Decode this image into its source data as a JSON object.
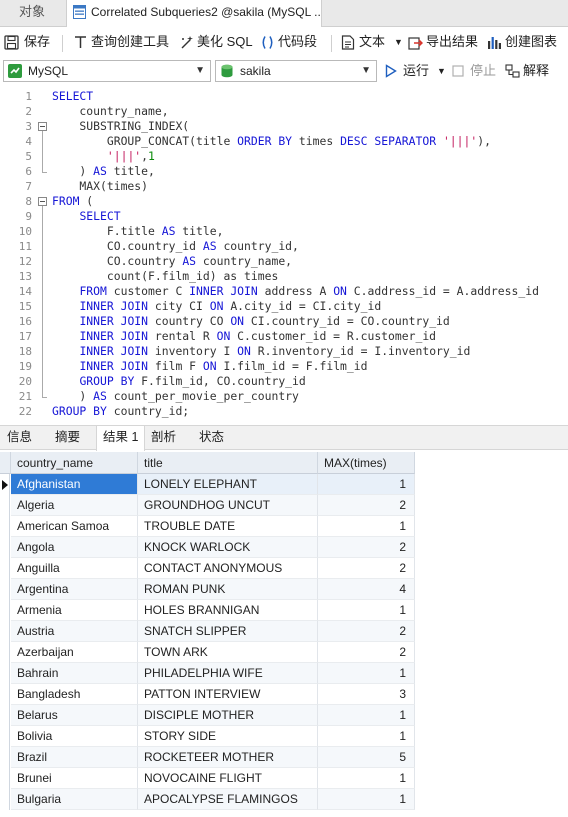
{
  "tabs": {
    "objects": "对象",
    "query": "Correlated Subqueries2 @sakila (MySQL ..."
  },
  "toolbar": {
    "save": "保存",
    "query_builder": "查询创建工具",
    "beautify": "美化 SQL",
    "snippet": "代码段",
    "text": "文本",
    "export": "导出结果",
    "create_chart": "创建图表"
  },
  "connection": {
    "server": "MySQL",
    "database": "sakila",
    "run": "运行",
    "stop": "停止",
    "explain": "解释"
  },
  "editor": {
    "lines": [
      {
        "n": "1",
        "html": "<span class='kw'>SELECT</span>"
      },
      {
        "n": "2",
        "html": "    country_name,"
      },
      {
        "n": "3",
        "html": "    SUBSTRING_INDEX("
      },
      {
        "n": "4",
        "html": "        GROUP_CONCAT(title <span class='kw'>ORDER BY</span> times <span class='kw'>DESC SEPARATOR</span> <span class='str'>'|||'</span>),"
      },
      {
        "n": "5",
        "html": "        <span class='str'>'|||'</span>,<span class='num'>1</span>"
      },
      {
        "n": "6",
        "html": "    ) <span class='kw'>AS</span> title,"
      },
      {
        "n": "7",
        "html": "    MAX(times)"
      },
      {
        "n": "8",
        "html": "<span class='kw'>FROM</span> ("
      },
      {
        "n": "9",
        "html": "    <span class='kw'>SELECT</span>"
      },
      {
        "n": "10",
        "html": "        F.title <span class='kw'>AS</span> title,"
      },
      {
        "n": "11",
        "html": "        CO.country_id <span class='kw'>AS</span> country_id,"
      },
      {
        "n": "12",
        "html": "        CO.country <span class='kw'>AS</span> country_name,"
      },
      {
        "n": "13",
        "html": "        count(F.film_id) as times"
      },
      {
        "n": "14",
        "html": "    <span class='kw'>FROM</span> customer C <span class='kw'>INNER JOIN</span> address A <span class='kw'>ON</span> C.address_id = A.address_id"
      },
      {
        "n": "15",
        "html": "    <span class='kw'>INNER JOIN</span> city CI <span class='kw'>ON</span> A.city_id = CI.city_id"
      },
      {
        "n": "16",
        "html": "    <span class='kw'>INNER JOIN</span> country CO <span class='kw'>ON</span> CI.country_id = CO.country_id"
      },
      {
        "n": "17",
        "html": "    <span class='kw'>INNER JOIN</span> rental R <span class='kw'>ON</span> C.customer_id = R.customer_id"
      },
      {
        "n": "18",
        "html": "    <span class='kw'>INNER JOIN</span> inventory I <span class='kw'>ON</span> R.inventory_id = I.inventory_id"
      },
      {
        "n": "19",
        "html": "    <span class='kw'>INNER JOIN</span> film F <span class='kw'>ON</span> I.film_id = F.film_id"
      },
      {
        "n": "20",
        "html": "    <span class='kw'>GROUP BY</span> F.film_id, CO.country_id"
      },
      {
        "n": "21",
        "html": "    ) <span class='kw'>AS</span> count_per_movie_per_country"
      },
      {
        "n": "22",
        "html": "<span class='kw'>GROUP BY</span> country_id;"
      }
    ]
  },
  "result_tabs": [
    "信息",
    "摘要",
    "结果 1",
    "剖析",
    "状态"
  ],
  "grid": {
    "columns": [
      "country_name",
      "title",
      "MAX(times)"
    ],
    "rows": [
      [
        "Afghanistan",
        "LONELY ELEPHANT",
        "1"
      ],
      [
        "Algeria",
        "GROUNDHOG UNCUT",
        "2"
      ],
      [
        "American Samoa",
        "TROUBLE DATE",
        "1"
      ],
      [
        "Angola",
        "KNOCK WARLOCK",
        "2"
      ],
      [
        "Anguilla",
        "CONTACT ANONYMOUS",
        "2"
      ],
      [
        "Argentina",
        "ROMAN PUNK",
        "4"
      ],
      [
        "Armenia",
        "HOLES BRANNIGAN",
        "1"
      ],
      [
        "Austria",
        "SNATCH SLIPPER",
        "2"
      ],
      [
        "Azerbaijan",
        "TOWN ARK",
        "2"
      ],
      [
        "Bahrain",
        "PHILADELPHIA WIFE",
        "1"
      ],
      [
        "Bangladesh",
        "PATTON INTERVIEW",
        "3"
      ],
      [
        "Belarus",
        "DISCIPLE MOTHER",
        "1"
      ],
      [
        "Bolivia",
        "STORY SIDE",
        "1"
      ],
      [
        "Brazil",
        "ROCKETEER MOTHER",
        "5"
      ],
      [
        "Brunei",
        "NOVOCAINE FLIGHT",
        "1"
      ],
      [
        "Bulgaria",
        "APOCALYPSE FLAMINGOS",
        "1"
      ]
    ]
  }
}
